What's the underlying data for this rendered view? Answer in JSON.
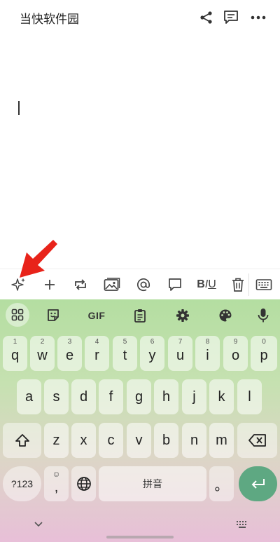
{
  "header": {
    "title": "当快软件园",
    "icons": [
      "share-icon",
      "comment-icon",
      "more-icon"
    ]
  },
  "toolbar": {
    "icons": [
      "ai-sparkle-icon",
      "add-icon",
      "convert-icon",
      "image-icon",
      "mention-icon",
      "comment-icon",
      "text-format-icon",
      "delete-icon",
      "keyboard-toggle-icon"
    ],
    "bold": "B",
    "italic": "I",
    "underline": "U"
  },
  "keyboard": {
    "top_row": {
      "gif_label": "GIF",
      "icons": [
        "apps-grid-icon",
        "sticker-icon",
        "clipboard-icon",
        "settings-icon",
        "palette-icon",
        "mic-icon"
      ]
    },
    "row1": [
      {
        "key": "q",
        "hint": "1"
      },
      {
        "key": "w",
        "hint": "2"
      },
      {
        "key": "e",
        "hint": "3"
      },
      {
        "key": "r",
        "hint": "4"
      },
      {
        "key": "t",
        "hint": "5"
      },
      {
        "key": "y",
        "hint": "6"
      },
      {
        "key": "u",
        "hint": "7"
      },
      {
        "key": "i",
        "hint": "8"
      },
      {
        "key": "o",
        "hint": "9"
      },
      {
        "key": "p",
        "hint": "0"
      }
    ],
    "row2": [
      "a",
      "s",
      "d",
      "f",
      "g",
      "h",
      "j",
      "k",
      "l"
    ],
    "row3": [
      "z",
      "x",
      "c",
      "v",
      "b",
      "n",
      "m"
    ],
    "bottom": {
      "symbols": "?123",
      "emoji_hint": "☺",
      "comma": ",",
      "space": "拼音",
      "period": "。"
    }
  },
  "accent_colors": {
    "enter": "#5ea882",
    "arrow": "#e8231a"
  }
}
